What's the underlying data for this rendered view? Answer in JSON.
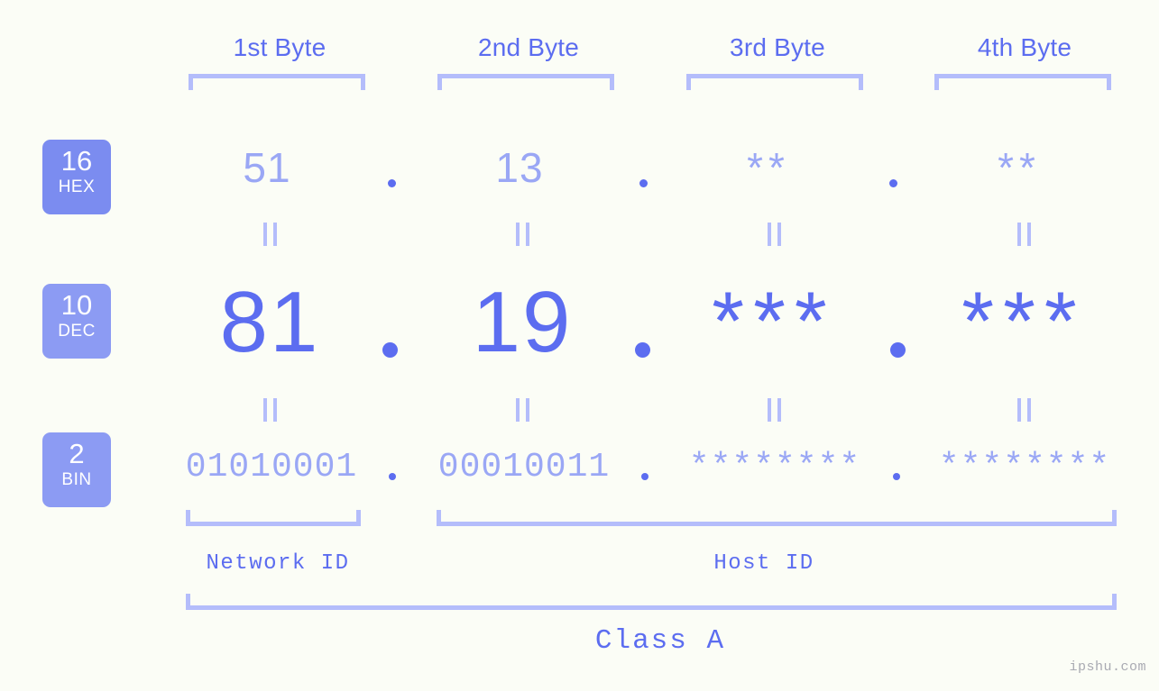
{
  "meta": {
    "watermark": "ipshu.com",
    "accent": "#5c6df0",
    "accent_light": "#9aa7f5",
    "bracket": "#b4bdfb",
    "badge": "#7b8cf0",
    "background": "#fbfdf6"
  },
  "headers": [
    {
      "label": "1st Byte"
    },
    {
      "label": "2nd Byte"
    },
    {
      "label": "3rd Byte"
    },
    {
      "label": "4th Byte"
    }
  ],
  "bases": [
    {
      "num": "16",
      "name": "HEX"
    },
    {
      "num": "10",
      "name": "DEC"
    },
    {
      "num": "2",
      "name": "BIN"
    }
  ],
  "rows": {
    "hex": {
      "base_num": "16",
      "base_name": "HEX",
      "values": [
        "51",
        "13",
        "**",
        "**"
      ]
    },
    "dec": {
      "base_num": "10",
      "base_name": "DEC",
      "values": [
        "81",
        "19",
        "***",
        "***"
      ]
    },
    "bin": {
      "base_num": "2",
      "base_name": "BIN",
      "values": [
        "01010001",
        "00010011",
        "********",
        "********"
      ]
    }
  },
  "separators": {
    "dot": ".",
    "equals": "||"
  },
  "sections": {
    "network_id": "Network ID",
    "host_id": "Host ID",
    "class": "Class A"
  }
}
